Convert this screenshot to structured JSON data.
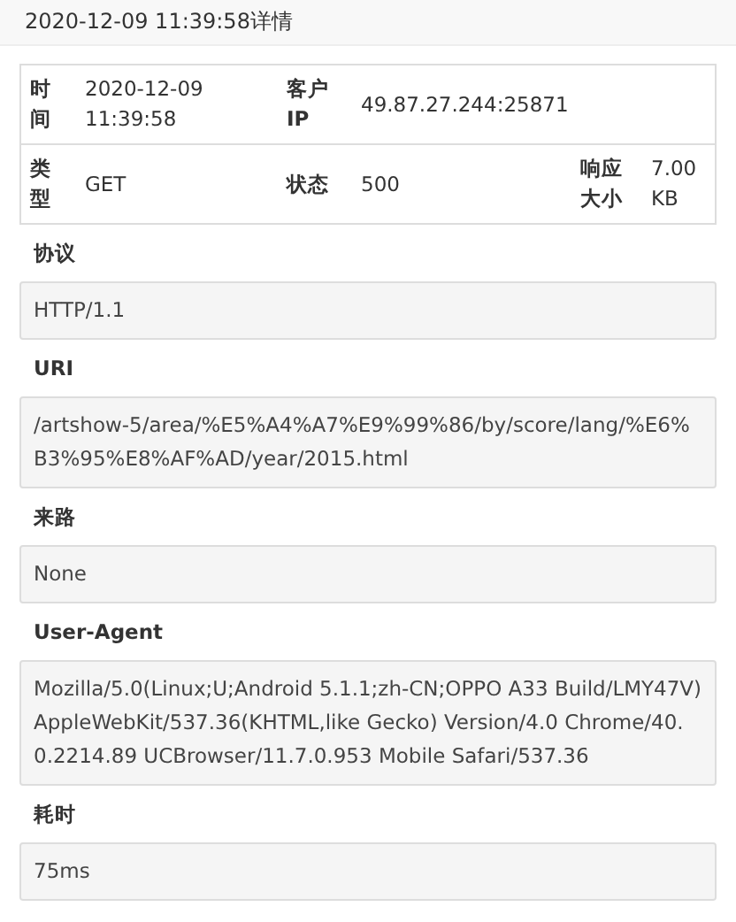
{
  "title": "2020-12-09 11:39:58详情",
  "table": {
    "rows": [
      [
        {
          "label": "时间",
          "value": "2020-12-09 11:39:58"
        },
        {
          "label": "客户IP",
          "value": "49.87.27.244:25871"
        }
      ],
      [
        {
          "label": "类型",
          "value": "GET"
        },
        {
          "label": "状态",
          "value": "500"
        },
        {
          "label": "响应大小",
          "value": "7.00 KB"
        }
      ]
    ]
  },
  "sections": [
    {
      "label": "协议",
      "value": "HTTP/1.1"
    },
    {
      "label": "URI",
      "value": "/artshow-5/area/%E5%A4%A7%E9%99%86/by/score/lang/%E6%B3%95%E8%AF%AD/year/2015.html"
    },
    {
      "label": "来路",
      "value": "None"
    },
    {
      "label": "User-Agent",
      "value": "Mozilla/5.0(Linux;U;Android 5.1.1;zh-CN;OPPO A33 Build/LMY47V) AppleWebKit/537.36(KHTML,like Gecko) Version/4.0 Chrome/40.0.2214.89 UCBrowser/11.7.0.953 Mobile Safari/537.36"
    },
    {
      "label": "耗时",
      "value": "75ms"
    }
  ]
}
